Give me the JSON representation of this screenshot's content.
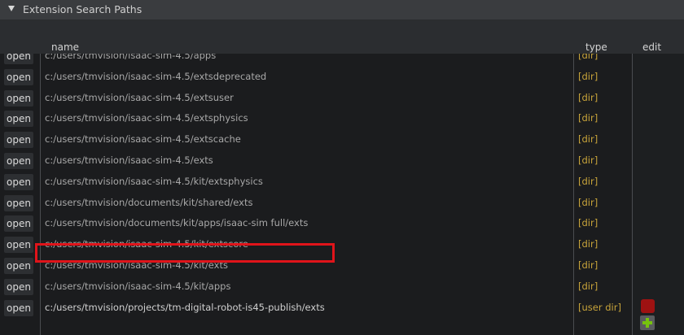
{
  "section": {
    "title": "Extension Search Paths",
    "expanded": true
  },
  "columns": {
    "name": "name",
    "type": "type",
    "edit": "edit"
  },
  "open_label": "open",
  "rows": [
    {
      "open": "open",
      "path": "c:/users/tmvision/isaac-sim-4.5/apps",
      "type": "[dir]"
    },
    {
      "open": "open",
      "path": "c:/users/tmvision/isaac-sim-4.5/extsdeprecated",
      "type": "[dir]"
    },
    {
      "open": "open",
      "path": "c:/users/tmvision/isaac-sim-4.5/extsuser",
      "type": "[dir]"
    },
    {
      "open": "open",
      "path": "c:/users/tmvision/isaac-sim-4.5/extsphysics",
      "type": "[dir]"
    },
    {
      "open": "open",
      "path": "c:/users/tmvision/isaac-sim-4.5/extscache",
      "type": "[dir]"
    },
    {
      "open": "open",
      "path": "c:/users/tmvision/isaac-sim-4.5/exts",
      "type": "[dir]"
    },
    {
      "open": "open",
      "path": "c:/users/tmvision/isaac-sim-4.5/kit/extsphysics",
      "type": "[dir]"
    },
    {
      "open": "open",
      "path": "c:/users/tmvision/documents/kit/shared/exts",
      "type": "[dir]"
    },
    {
      "open": "open",
      "path": "c:/users/tmvision/documents/kit/apps/isaac-sim full/exts",
      "type": "[dir]"
    },
    {
      "open": "open",
      "path": "c:/users/tmvision/isaac-sim-4.5/kit/extscore",
      "type": "[dir]"
    },
    {
      "open": "open",
      "path": "c:/users/tmvision/isaac-sim-4.5/kit/exts",
      "type": "[dir]"
    },
    {
      "open": "open",
      "path": "c:/users/tmvision/isaac-sim-4.5/kit/apps",
      "type": "[dir]"
    },
    {
      "open": "open",
      "path": "c:/users/tmvision/projects/tm-digital-robot-is45-publish/exts",
      "type": "[user dir]",
      "highlighted": true
    }
  ],
  "colors": {
    "type_text": "#c8a43a",
    "highlight_border": "#e0141a",
    "remove_button": "#9e1212",
    "add_button_plus": "#76c20e"
  },
  "icons": {
    "collapse": "triangle-down-icon",
    "remove": "remove-square-icon",
    "add": "plus-icon"
  }
}
